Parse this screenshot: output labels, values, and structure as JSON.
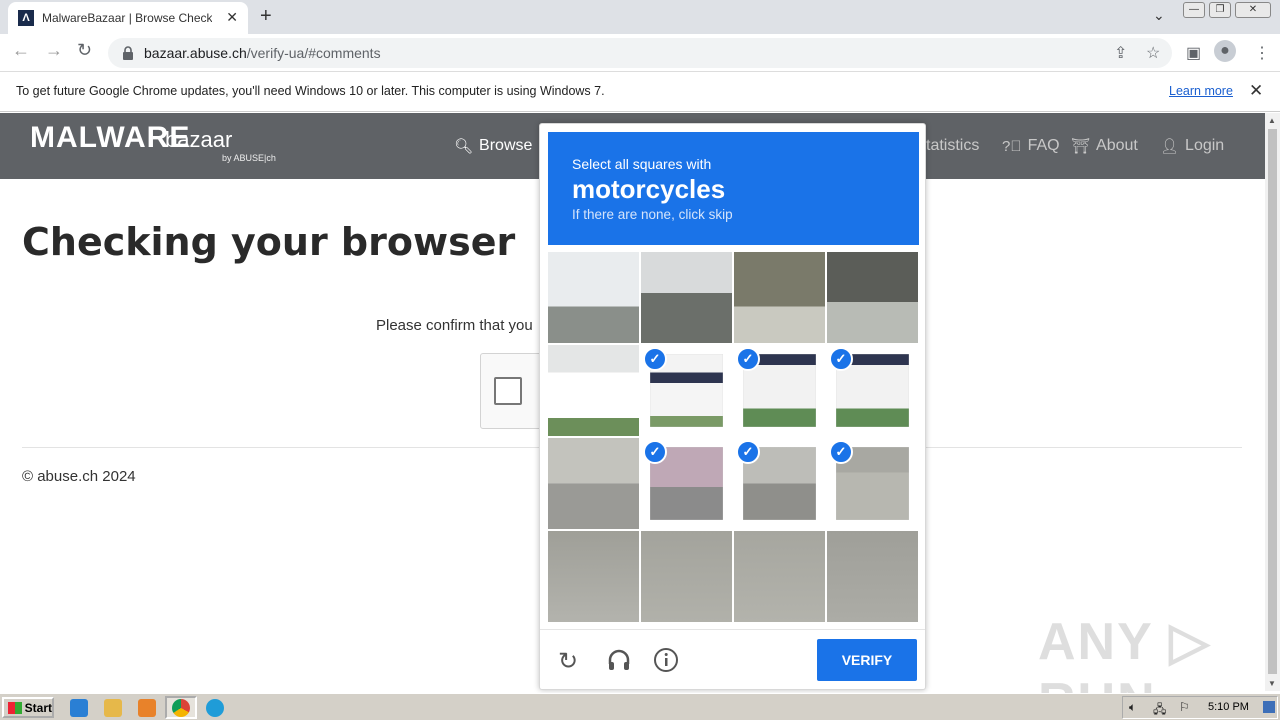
{
  "browser": {
    "tab_title": "MalwareBazaar | Browse Checking y",
    "favicon_letter": "Λ",
    "url_host": "bazaar.abuse.ch",
    "url_path": "/verify-ua/#comments"
  },
  "infobar": {
    "message": "To get future Google Chrome updates, you'll need Windows 10 or later. This computer is using Windows 7.",
    "learn_more": "Learn more"
  },
  "site": {
    "logo_main": "MALWARE",
    "logo_sub": "bazaar",
    "logo_by": "by ABUSE|ch",
    "nav": {
      "browse": "Browse",
      "statistics": "tatistics",
      "faq": "FAQ",
      "about": "About",
      "login": "Login"
    }
  },
  "page": {
    "title": "Checking your browser",
    "confirm_text": "Please confirm that you",
    "footer": "© abuse.ch 2024"
  },
  "captcha": {
    "prompt": "Select all squares with",
    "target": "motorcycles",
    "skip_hint": "If there are none, click skip",
    "verify_label": "VERIFY",
    "accent": "#1a73e8",
    "selected_tiles": [
      6,
      7,
      8,
      10,
      11,
      12
    ]
  },
  "taskbar": {
    "start_label": "Start",
    "clock": "5:10 PM"
  },
  "watermark": "ANY ▷ RUN"
}
